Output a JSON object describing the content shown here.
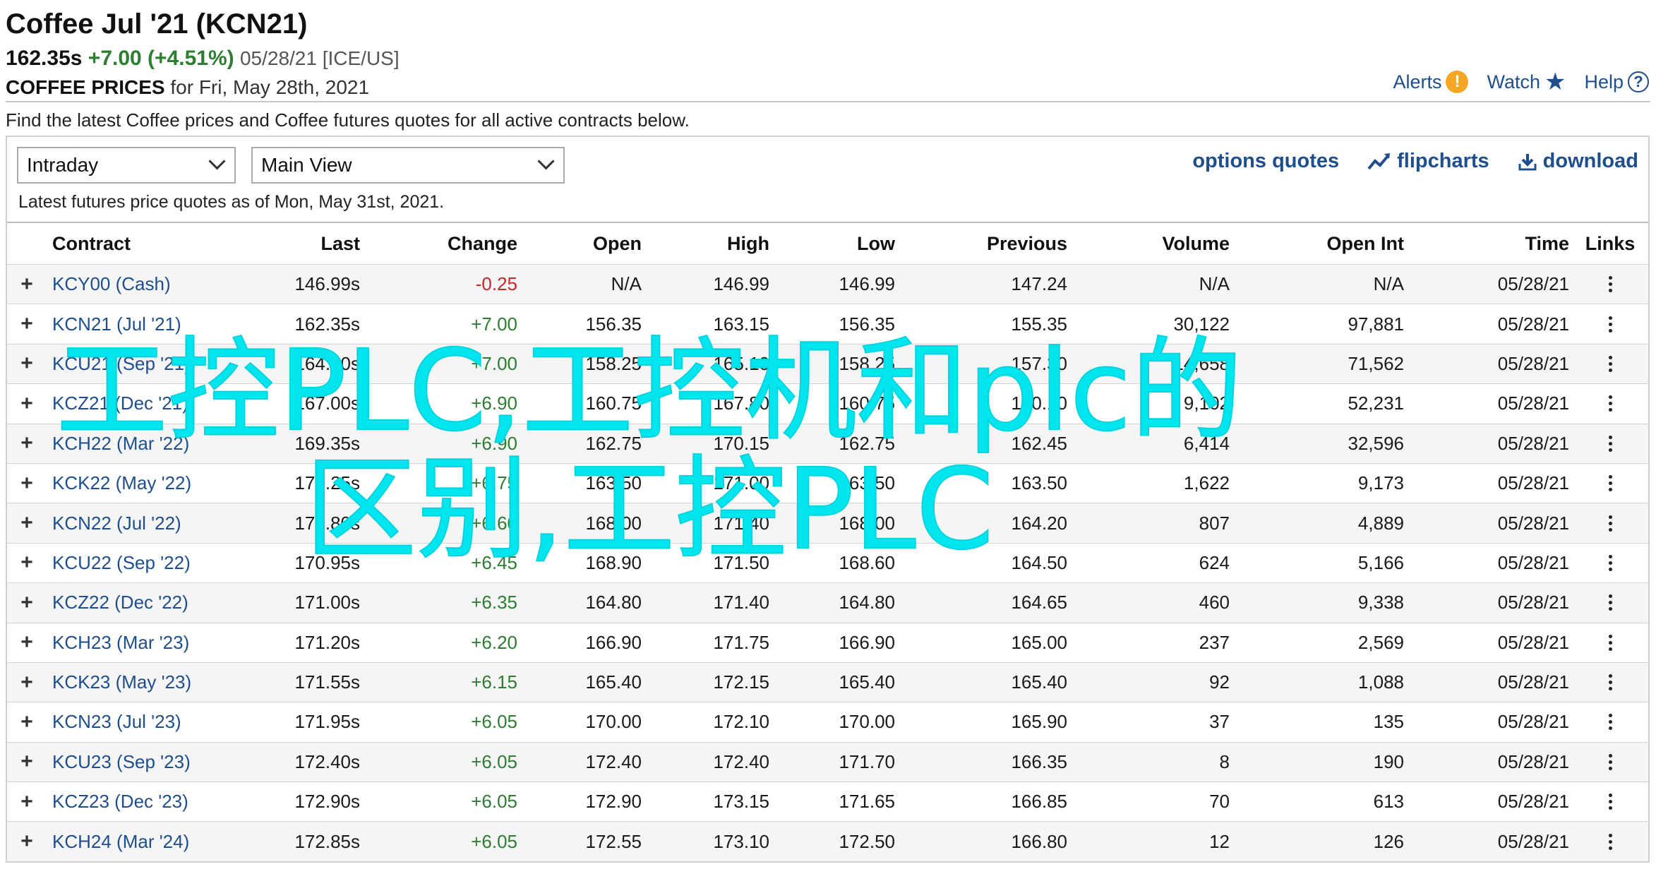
{
  "header": {
    "title": "Coffee Jul '21 (KCN21)",
    "last": "162.35s",
    "change": "+7.00 (+4.51%)",
    "date_exchange": "05/28/21 [ICE/US]",
    "prices_label": "COFFEE PRICES",
    "prices_date": " for Fri, May 28th, 2021"
  },
  "toplinks": {
    "alerts": "Alerts",
    "watch": "Watch",
    "help": "Help"
  },
  "description": "Find the latest Coffee prices and Coffee futures quotes for all active contracts below.",
  "controls": {
    "period_select": "Intraday",
    "view_select": "Main View",
    "options_quotes": "options quotes",
    "flipcharts": "flipcharts",
    "download": "download"
  },
  "as_of": "Latest futures price quotes as of Mon, May 31st, 2021.",
  "table": {
    "headers": {
      "contract": "Contract",
      "last": "Last",
      "change": "Change",
      "open": "Open",
      "high": "High",
      "low": "Low",
      "previous": "Previous",
      "volume": "Volume",
      "open_int": "Open Int",
      "time": "Time",
      "links": "Links"
    },
    "rows": [
      {
        "contract": "KCY00 (Cash)",
        "last": "146.99s",
        "change": "-0.25",
        "open": "N/A",
        "high": "146.99",
        "low": "146.99",
        "previous": "147.24",
        "volume": "N/A",
        "open_int": "N/A",
        "time": "05/28/21"
      },
      {
        "contract": "KCN21 (Jul '21)",
        "last": "162.35s",
        "change": "+7.00",
        "open": "156.35",
        "high": "163.15",
        "low": "156.35",
        "previous": "155.35",
        "volume": "30,122",
        "open_int": "97,881",
        "time": "05/28/21"
      },
      {
        "contract": "KCU21 (Sep '21)",
        "last": "164.30s",
        "change": "+7.00",
        "open": "158.25",
        "high": "165.10",
        "low": "158.25",
        "previous": "157.30",
        "volume": "14,658",
        "open_int": "71,562",
        "time": "05/28/21"
      },
      {
        "contract": "KCZ21 (Dec '21)",
        "last": "167.00s",
        "change": "+6.90",
        "open": "160.75",
        "high": "167.80",
        "low": "160.75",
        "previous": "160.10",
        "volume": "9,102",
        "open_int": "52,231",
        "time": "05/28/21"
      },
      {
        "contract": "KCH22 (Mar '22)",
        "last": "169.35s",
        "change": "+6.90",
        "open": "162.75",
        "high": "170.15",
        "low": "162.75",
        "previous": "162.45",
        "volume": "6,414",
        "open_int": "32,596",
        "time": "05/28/21"
      },
      {
        "contract": "KCK22 (May '22)",
        "last": "170.25s",
        "change": "+6.75",
        "open": "163.50",
        "high": "171.00",
        "low": "163.50",
        "previous": "163.50",
        "volume": "1,622",
        "open_int": "9,173",
        "time": "05/28/21"
      },
      {
        "contract": "KCN22 (Jul '22)",
        "last": "170.80s",
        "change": "+6.60",
        "open": "168.00",
        "high": "171.40",
        "low": "168.00",
        "previous": "164.20",
        "volume": "807",
        "open_int": "4,889",
        "time": "05/28/21"
      },
      {
        "contract": "KCU22 (Sep '22)",
        "last": "170.95s",
        "change": "+6.45",
        "open": "168.90",
        "high": "171.50",
        "low": "168.60",
        "previous": "164.50",
        "volume": "624",
        "open_int": "5,166",
        "time": "05/28/21"
      },
      {
        "contract": "KCZ22 (Dec '22)",
        "last": "171.00s",
        "change": "+6.35",
        "open": "164.80",
        "high": "171.40",
        "low": "164.80",
        "previous": "164.65",
        "volume": "460",
        "open_int": "9,338",
        "time": "05/28/21"
      },
      {
        "contract": "KCH23 (Mar '23)",
        "last": "171.20s",
        "change": "+6.20",
        "open": "166.90",
        "high": "171.75",
        "low": "166.90",
        "previous": "165.00",
        "volume": "237",
        "open_int": "2,569",
        "time": "05/28/21"
      },
      {
        "contract": "KCK23 (May '23)",
        "last": "171.55s",
        "change": "+6.15",
        "open": "165.40",
        "high": "172.15",
        "low": "165.40",
        "previous": "165.40",
        "volume": "92",
        "open_int": "1,088",
        "time": "05/28/21"
      },
      {
        "contract": "KCN23 (Jul '23)",
        "last": "171.95s",
        "change": "+6.05",
        "open": "170.00",
        "high": "172.10",
        "low": "170.00",
        "previous": "165.90",
        "volume": "37",
        "open_int": "135",
        "time": "05/28/21"
      },
      {
        "contract": "KCU23 (Sep '23)",
        "last": "172.40s",
        "change": "+6.05",
        "open": "172.40",
        "high": "172.40",
        "low": "171.70",
        "previous": "166.35",
        "volume": "8",
        "open_int": "190",
        "time": "05/28/21"
      },
      {
        "contract": "KCZ23 (Dec '23)",
        "last": "172.90s",
        "change": "+6.05",
        "open": "172.90",
        "high": "173.15",
        "low": "171.65",
        "previous": "166.85",
        "volume": "70",
        "open_int": "613",
        "time": "05/28/21"
      },
      {
        "contract": "KCH24 (Mar '24)",
        "last": "172.85s",
        "change": "+6.05",
        "open": "172.55",
        "high": "173.10",
        "low": "172.50",
        "previous": "166.80",
        "volume": "12",
        "open_int": "126",
        "time": "05/28/21"
      }
    ]
  },
  "watermark": {
    "line1": "工控PLC,工控机和plc的",
    "line2": "区别,工控PLC"
  },
  "colors": {
    "link": "#1f4e8c",
    "positive": "#2e7d32",
    "negative": "#c62828",
    "watermark": "#00e5ee",
    "alert": "#f5a623"
  },
  "icons": {
    "alerts": "exclamation-circle-icon",
    "watch": "star-icon",
    "help": "question-circle-icon",
    "flipcharts": "line-chart-icon",
    "download": "download-icon",
    "expand": "plus-icon",
    "links": "kebab-menu-icon"
  }
}
